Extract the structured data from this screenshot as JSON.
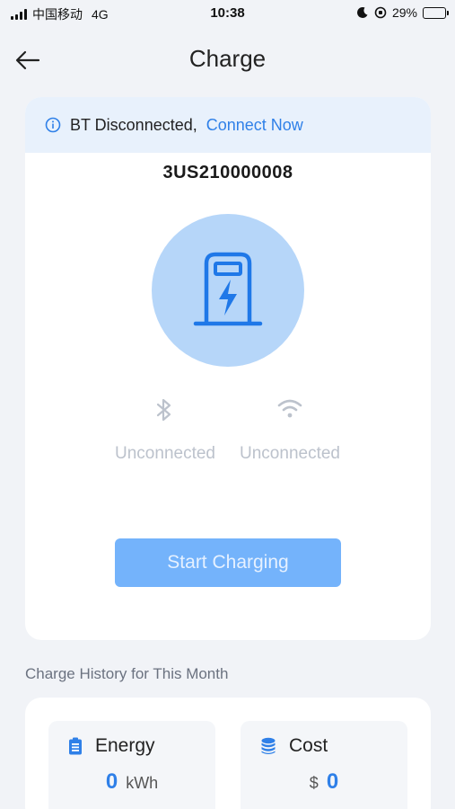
{
  "status_bar": {
    "carrier": "中国移动",
    "network": "4G",
    "time": "10:38",
    "battery": "29%",
    "battery_level": 0.29
  },
  "header": {
    "title": "Charge"
  },
  "bt_banner": {
    "message": "BT Disconnected,",
    "action": "Connect Now"
  },
  "device": {
    "id": "3US210000008"
  },
  "connections": {
    "bluetooth_status": "Unconnected",
    "wifi_status": "Unconnected"
  },
  "actions": {
    "start_label": "Start Charging"
  },
  "history": {
    "title": "Charge History for This Month",
    "energy_label": "Energy",
    "energy_value": "0",
    "energy_unit": "kWh",
    "cost_label": "Cost",
    "cost_currency": "$",
    "cost_value": "0"
  },
  "colors": {
    "accent": "#2f80e8",
    "button": "#74b3fb",
    "banner": "#e8f1fc",
    "charger_circle": "#b6d6f9"
  }
}
